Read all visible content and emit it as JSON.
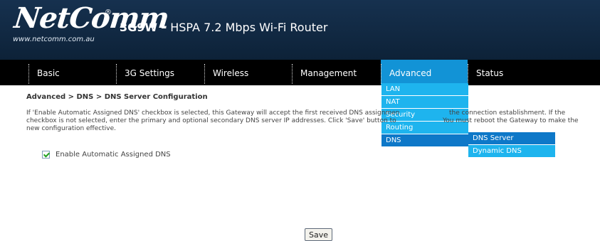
{
  "brand": {
    "logo_text": "NetComm",
    "reg_mark": "®",
    "url": "www.netcomm.com.au",
    "model": "3G9W",
    "product": " – HSPA 7.2 Mbps Wi-Fi Router"
  },
  "nav": {
    "items": [
      {
        "label": "Basic"
      },
      {
        "label": "3G Settings"
      },
      {
        "label": "Wireless"
      },
      {
        "label": "Management"
      },
      {
        "label": "Advanced"
      },
      {
        "label": "Status"
      }
    ],
    "active": "Advanced"
  },
  "dropdown": {
    "items": [
      {
        "label": "LAN"
      },
      {
        "label": "NAT"
      },
      {
        "label": "Security"
      },
      {
        "label": "Routing"
      },
      {
        "label": "DNS"
      }
    ],
    "selected": "DNS"
  },
  "submenu": {
    "items": [
      {
        "label": "DNS Server"
      },
      {
        "label": "Dynamic DNS"
      }
    ],
    "selected": "DNS Server"
  },
  "page": {
    "breadcrumb": "Advanced > DNS > DNS Server Configuration",
    "description": "If 'Enable Automatic Assigned DNS' checkbox is selected, this Gateway will accept the first received DNS assignment ... the connection establishment. If the checkbox is not selected, enter the primary and optional secondary DNS server IP addresses. Click 'Save' button to ... You must reboot the Gateway to make the new configuration effective.",
    "desc_line1_left": "If 'Enable Automatic Assigned DNS' checkbox is selected, this Gateway will accept the first received DNS assignmen",
    "desc_line1_right": "the connection establishment. If the",
    "desc_line2_left": "checkbox is not selected, enter the primary and optional secondary DNS server IP addresses. Click 'Save' button to",
    "desc_line2_right": "You must reboot the Gateway to make the",
    "desc_line3": "new configuration effective.",
    "checkbox_label": "Enable Automatic Assigned DNS",
    "checkbox_checked": true,
    "save_label": "Save"
  },
  "colors": {
    "header": "#16314f",
    "navbar": "#000000",
    "active_tab": "#1293d6",
    "menu_item": "#1eb4ee",
    "menu_selected": "#0e78c8"
  }
}
